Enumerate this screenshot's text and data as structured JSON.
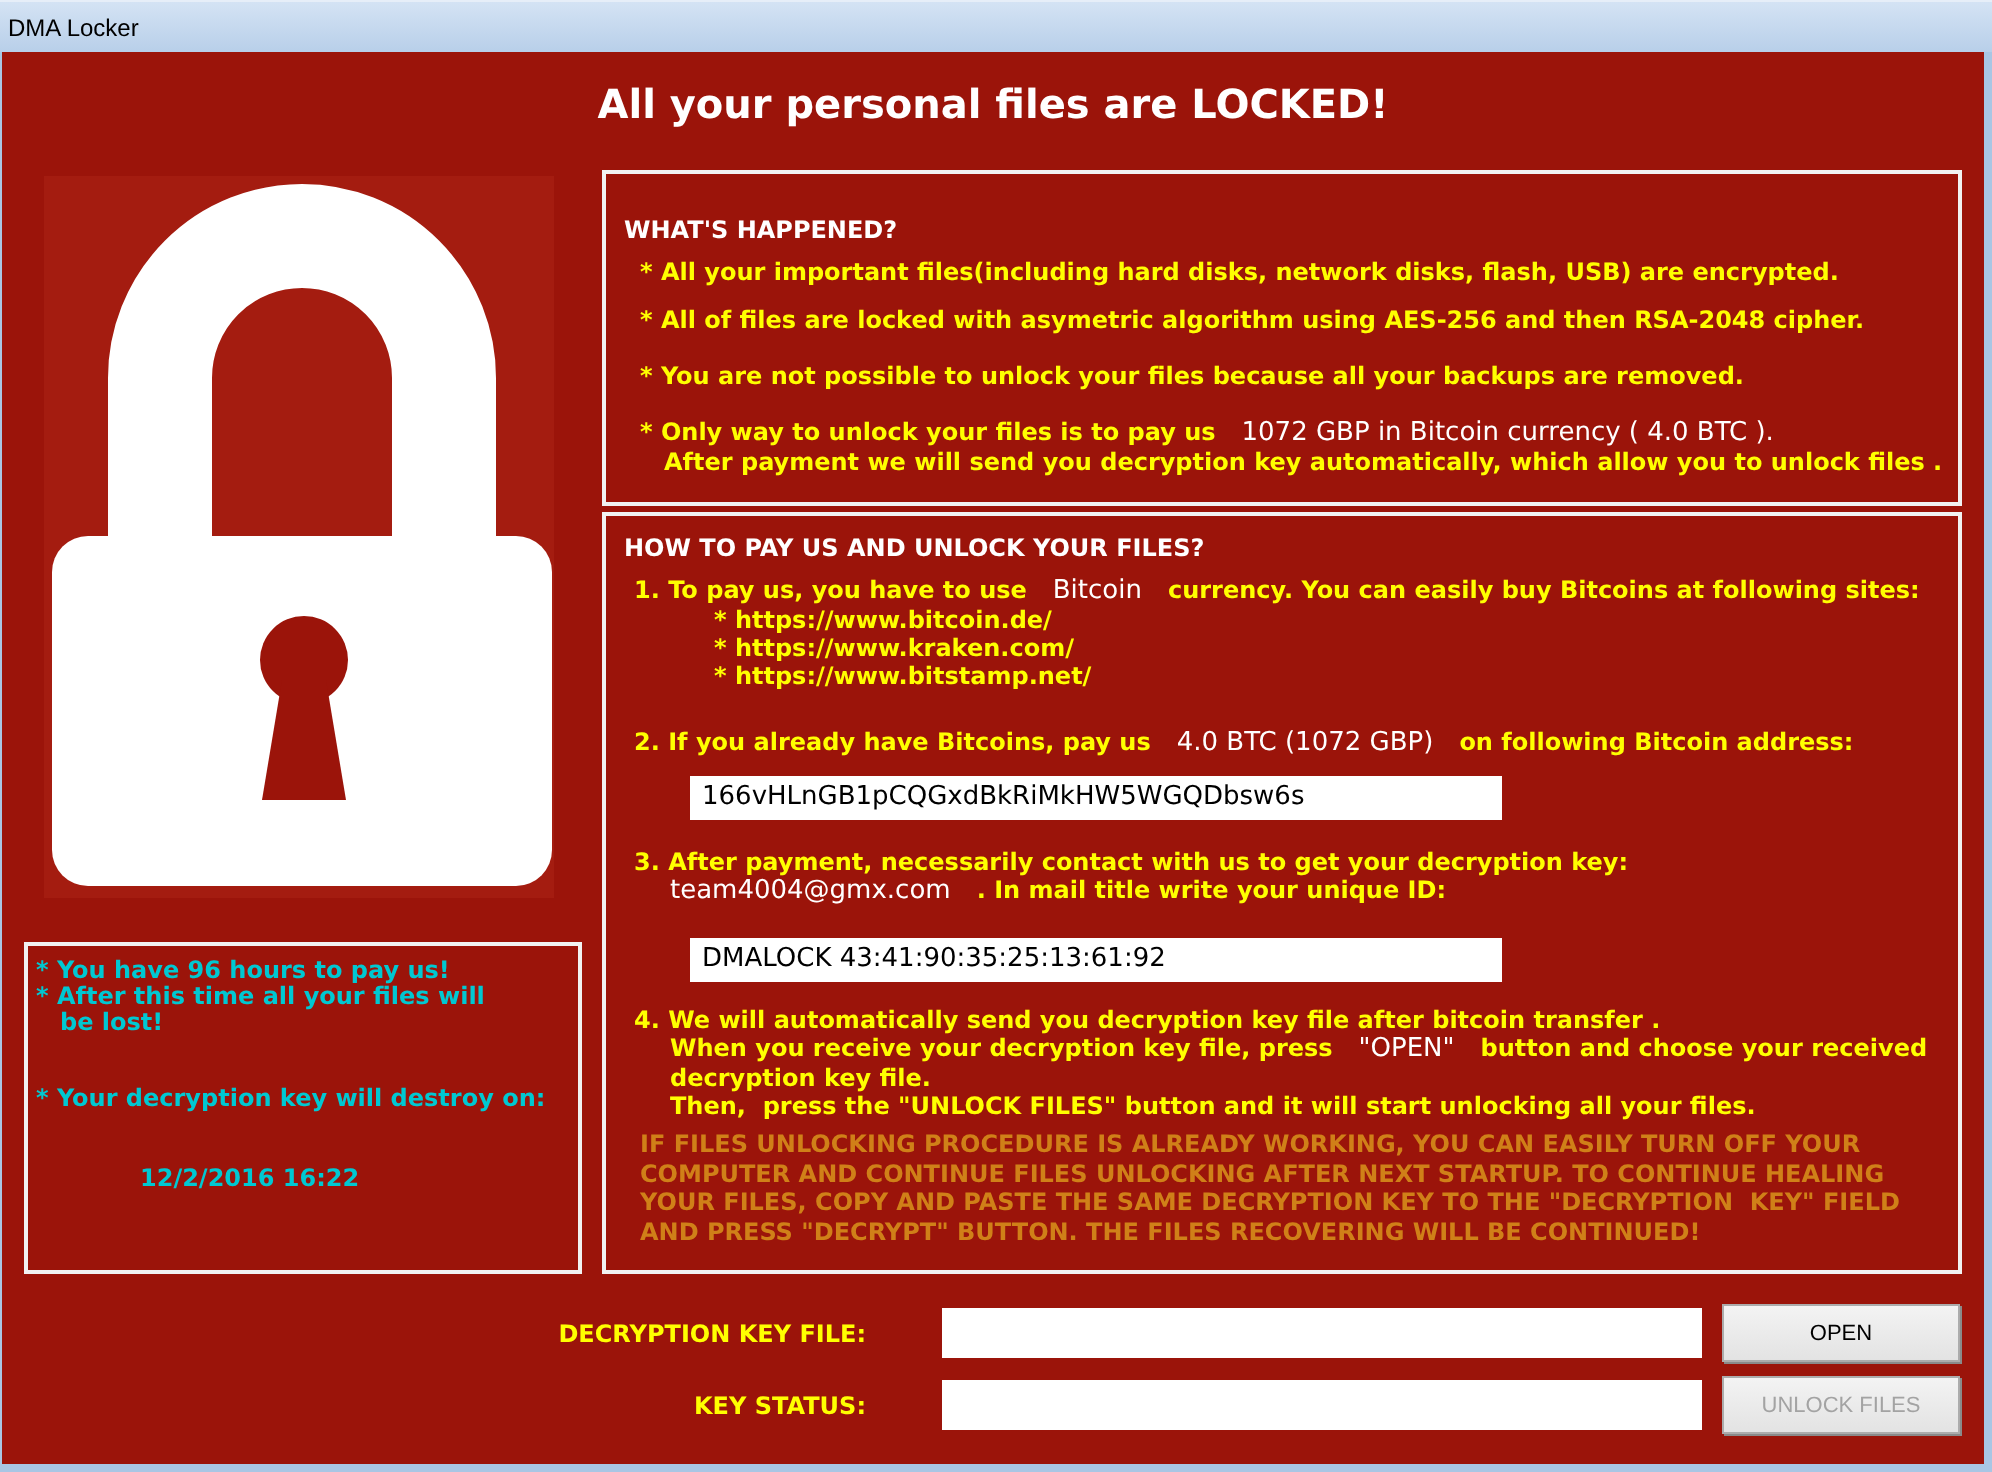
{
  "window": {
    "title": "DMA Locker"
  },
  "headline": "All your personal files are LOCKED!",
  "notice_panel": {
    "items": [
      {
        "kind": "notice",
        "text": "* You have 96 hours to pay us!"
      },
      {
        "kind": "notice",
        "text": "* After this time all your files will\nbe lost!"
      },
      {
        "kind": "notice",
        "text": "* Your decryption key will destroy on:"
      },
      {
        "kind": "deadline",
        "text": "12/2/2016 16:22"
      }
    ]
  },
  "whats_happened": {
    "heading": "WHAT'S HAPPENED?",
    "lines": [
      {
        "kind": "bullet",
        "segments": [
          {
            "kind": "plain",
            "text": "* All your important files(including hard disks, network disks, flash, USB) are encrypted."
          }
        ]
      },
      {
        "kind": "bullet",
        "segments": [
          {
            "kind": "plain",
            "text": "* All of files are locked with asymetric algorithm using AES-256 and then RSA-2048 cipher."
          }
        ]
      },
      {
        "kind": "bullet",
        "segments": [
          {
            "kind": "plain",
            "text": "* You are not possible to unlock your files because all your backups are removed."
          }
        ]
      },
      {
        "kind": "bullet",
        "segments": [
          {
            "kind": "plain",
            "text": "* Only way to unlock your files is to pay us"
          },
          {
            "kind": "amount",
            "text": "1072 GBP in Bitcoin currency ( 4.0 BTC )."
          }
        ]
      },
      {
        "kind": "continuation",
        "segments": [
          {
            "kind": "plain",
            "text": "After payment we will send you decryption key automatically, which allow you to unlock files ."
          }
        ]
      }
    ]
  },
  "how_to_pay": {
    "heading": "HOW TO PAY US AND UNLOCK YOUR FILES?",
    "steps": [
      {
        "lines": [
          {
            "kind": "first",
            "segments": [
              {
                "kind": "plain",
                "text": "1. To pay us, you have to use"
              },
              {
                "kind": "currency",
                "text": "Bitcoin"
              },
              {
                "kind": "plain",
                "text": "currency. You can easily buy Bitcoins at following sites:"
              }
            ]
          }
        ],
        "sites": [
          "* https://www.bitcoin.de/",
          "* https://www.kraken.com/",
          "* https://www.bitstamp.net/"
        ]
      },
      {
        "lines": [
          {
            "kind": "first",
            "segments": [
              {
                "kind": "plain",
                "text": "2. If you already have Bitcoins, pay us"
              },
              {
                "kind": "amount",
                "text": "4.0 BTC (1072 GBP)"
              },
              {
                "kind": "plain",
                "text": "on following Bitcoin address:"
              }
            ]
          }
        ],
        "field": {
          "value": "166vHLnGB1pCQGxdBkRiMkHW5WGQDbsw6s"
        }
      },
      {
        "lines": [
          {
            "kind": "first",
            "segments": [
              {
                "kind": "plain",
                "text": "3. After payment, necessarily contact with us to get your decryption key:"
              }
            ]
          },
          {
            "kind": "continuation",
            "segments": [
              {
                "kind": "email",
                "text": "team4004@gmx.com"
              },
              {
                "kind": "plain",
                "text": ". In mail title write your unique ID:"
              }
            ]
          }
        ],
        "field": {
          "value": "DMALOCK 43:41:90:35:25:13:61:92"
        }
      },
      {
        "lines": [
          {
            "kind": "first",
            "segments": [
              {
                "kind": "plain",
                "text": "4. We will automatically send you decryption key file after bitcoin transfer ."
              }
            ]
          },
          {
            "kind": "continuation",
            "segments": [
              {
                "kind": "plain",
                "text": "When you receive your decryption key file, press"
              },
              {
                "kind": "button_name",
                "text": "\"OPEN\""
              },
              {
                "kind": "plain",
                "text": "button and choose your received"
              }
            ]
          },
          {
            "kind": "continuation",
            "segments": [
              {
                "kind": "plain",
                "text": "decryption key file."
              }
            ]
          },
          {
            "kind": "continuation",
            "segments": [
              {
                "kind": "plain",
                "text": "Then,  press the \"UNLOCK FILES\" button and it will start unlocking all your files."
              }
            ]
          }
        ]
      }
    ],
    "warning": "IF FILES UNLOCKING PROCEDURE IS ALREADY WORKING, YOU CAN EASILY TURN OFF YOUR COMPUTER AND CONTINUE FILES UNLOCKING AFTER NEXT STARTUP. TO CONTINUE HEALING YOUR FILES, COPY AND PASTE THE SAME DECRYPTION KEY TO THE \"DECRYPTION  KEY\" FIELD AND PRESS \"DECRYPT\" BUTTON. THE FILES RECOVERING WILL BE CONTINUED!"
  },
  "controls": [
    {
      "label": "DECRYPTION KEY FILE:",
      "button": {
        "label": "OPEN",
        "disabled": false
      }
    },
    {
      "label": "KEY STATUS:",
      "button": {
        "label": "UNLOCK FILES",
        "disabled": true
      }
    }
  ]
}
